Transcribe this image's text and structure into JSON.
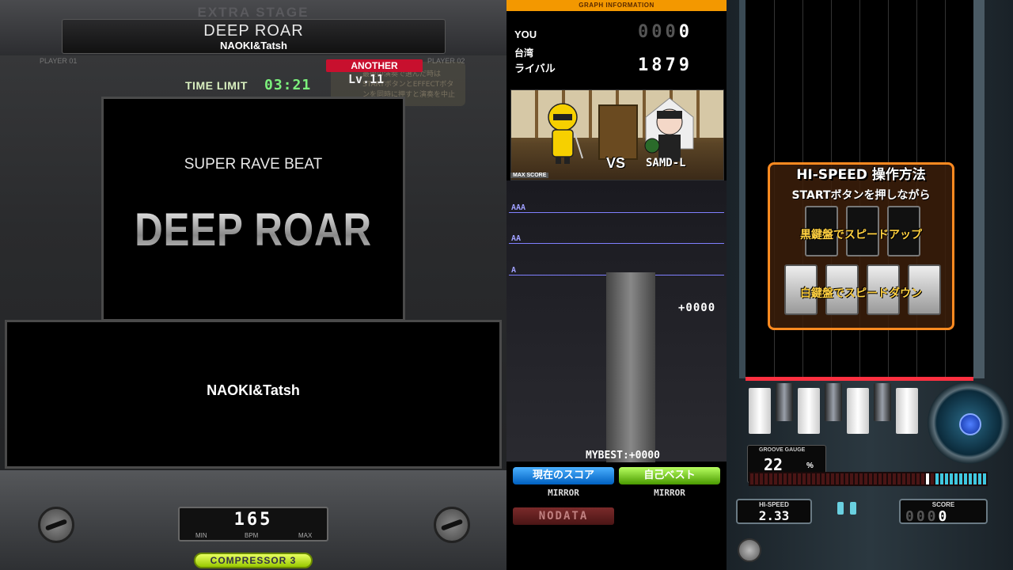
{
  "left": {
    "stage_label": "EXTRA STAGE",
    "song_title": "DEEP ROAR",
    "song_artist": "NAOKI&Tatsh",
    "player1": "PLAYER 01",
    "player2": "PLAYER 02",
    "difficulty": "ANOTHER",
    "level": "Lv.11",
    "ghost_message": "最後の演奏で選んだ時はSTARTボタンとEFFECTボタンを同時に押すと演奏を中止できます",
    "time_label": "TIME LIMIT",
    "time_value": "03:21",
    "bga_genre": "SUPER RAVE BEAT",
    "bga_title": "DEEP ROAR",
    "info_artist": "NAOKI&Tatsh",
    "bpm_value": "165",
    "bpm_min": "MIN",
    "bpm_label": "BPM",
    "bpm_max": "MAX",
    "compressor": "COMPRESSOR 3"
  },
  "middle": {
    "header": "GRAPH INFORMATION",
    "you_label": "YOU",
    "you_score_dim": "000",
    "you_score": "0",
    "region": "台湾",
    "rival_label": "ライバル",
    "rival_score": "1879",
    "vs": "VS",
    "rival_name": "SAMD-L",
    "maxscore_label": "MAX SCORE",
    "grades": [
      "AAA",
      "AA",
      "A"
    ],
    "diff_value": "+0000",
    "mybest": "MYBEST:+0000",
    "btn_current": "現在のスコア",
    "btn_best": "自己ベスト",
    "mirror_left": "MIRROR",
    "mirror_right": "MIRROR",
    "nodata": "NODATA"
  },
  "right": {
    "hs_title": "HI-SPEED 操作方法",
    "hs_sub": "STARTボタンを押しながら",
    "hs_up": "黒鍵盤でスピードアップ",
    "hs_down": "白鍵盤でスピードダウン",
    "gauge_label": "GROOVE GAUGE",
    "gauge_value": "22",
    "gauge_pct": "%",
    "hispeed_label": "HI-SPEED",
    "hispeed_value": "2.33",
    "score_label": "SCORE",
    "score_dim": "000",
    "score_value": "0",
    "groove_gauge_fraction": 0.22
  },
  "colors": {
    "accent_orange": "#f39800",
    "difficulty_red": "#c8102e",
    "judge_red": "#ff3040",
    "gauge_cyan": "#40c8e0"
  }
}
